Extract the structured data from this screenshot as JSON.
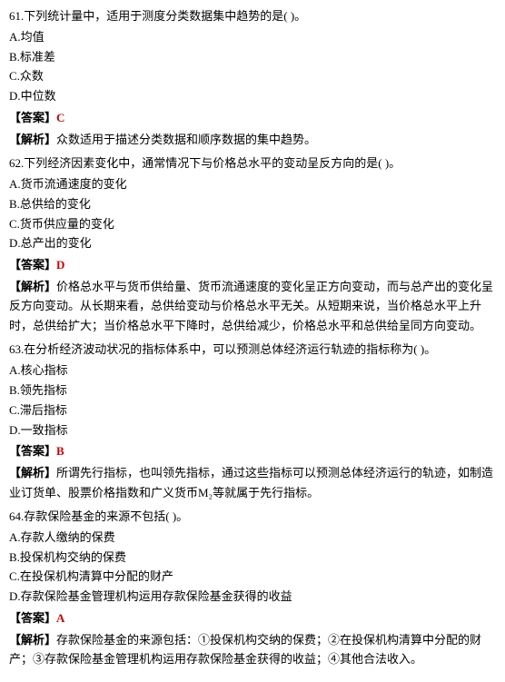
{
  "questions": [
    {
      "id": "q61",
      "title": "61.下列统计量中，适用于测度分类数据集中趋势的是(      )。",
      "options": [
        {
          "label": "A",
          "text": "均值"
        },
        {
          "label": "B",
          "text": "标准差"
        },
        {
          "label": "C",
          "text": "众数"
        },
        {
          "label": "D",
          "text": "中位数"
        }
      ],
      "answer_prefix": "【答案】",
      "answer_letter": "C",
      "analysis_prefix": "【解析】",
      "analysis_text": "众数适用于描述分类数据和顺序数据的集中趋势。"
    },
    {
      "id": "q62",
      "title": "62.下列经济因素变化中，通常情况下与价格总水平的变动呈反方向的是(      )。",
      "options": [
        {
          "label": "A",
          "text": "货币流通速度的变化"
        },
        {
          "label": "B",
          "text": "总供给的变化"
        },
        {
          "label": "C",
          "text": "货币供应量的变化"
        },
        {
          "label": "D",
          "text": "总产出的变化"
        }
      ],
      "answer_prefix": "【答案】",
      "answer_letter": "D",
      "analysis_prefix": "【解析】",
      "analysis_text": "价格总水平与货币供给量、货币流通速度的变化呈正方向变动，而与总产出的变化呈反方向变动。从长期来看，总供给变动与价格总水平无关。从短期来说，当价格总水平上升时，总供给扩大；当价格总水平下降时，总供给减少，价格总水平和总供给呈同方向变动。"
    },
    {
      "id": "q63",
      "title": "63.在分析经济波动状况的指标体系中，可以预测总体经济运行轨迹的指标称为(      )。",
      "options": [
        {
          "label": "A",
          "text": "核心指标"
        },
        {
          "label": "B",
          "text": "领先指标"
        },
        {
          "label": "C",
          "text": "滞后指标"
        },
        {
          "label": "D",
          "text": "一致指标"
        }
      ],
      "answer_prefix": "【答案】",
      "answer_letter": "B",
      "analysis_prefix": "【解析】",
      "analysis_text": "所谓先行指标，也叫领先指标，通过这些指标可以预测总体经济运行的轨迹，如制造业订货单、股票价格指数和广义货币M₂等就属于先行指标。"
    },
    {
      "id": "q64",
      "title": "64.存款保险基金的来源不包括(      )。",
      "options": [
        {
          "label": "A",
          "text": "存款人缴纳的保费"
        },
        {
          "label": "B",
          "text": "投保机构交纳的保费"
        },
        {
          "label": "C",
          "text": "在投保机构清算中分配的财产"
        },
        {
          "label": "D",
          "text": "存款保险基金管理机构运用存款保险基金获得的收益"
        }
      ],
      "answer_prefix": "【答案】",
      "answer_letter": "A",
      "analysis_prefix": "【解析】",
      "analysis_text": "存款保险基金的来源包括：①投保机构交纳的保费；②在投保机构清算中分配的财产；③存款保险基金管理机构运用存款保险基金获得的收益；④其他合法收入。"
    }
  ]
}
